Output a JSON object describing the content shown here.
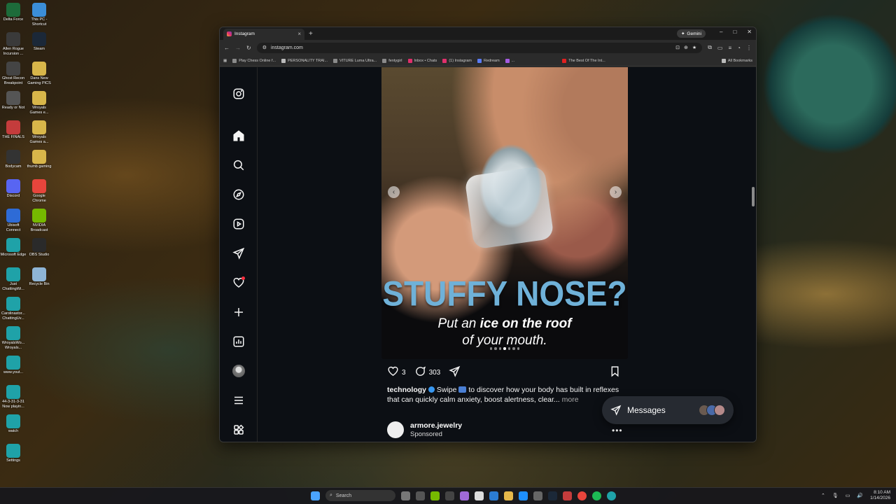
{
  "desktop": {
    "icons": [
      {
        "label": "Delta Force",
        "color": "#1d6b3a"
      },
      {
        "label": "This PC - Shortcut",
        "color": "#3b8ed8"
      },
      {
        "label": "Allen Rogue Incursion ...",
        "color": "#3a3a3a"
      },
      {
        "label": "Steam",
        "color": "#1b2838"
      },
      {
        "label": "Ghost Recon Breakpoint",
        "color": "#444"
      },
      {
        "label": "Dans New Gaming PICS",
        "color": "#d8b64a"
      },
      {
        "label": "Ready or Not",
        "color": "#555"
      },
      {
        "label": "Wroyals Games e...",
        "color": "#d8b64a"
      },
      {
        "label": "THE FINALS",
        "color": "#c43c3c"
      },
      {
        "label": "Wroyals Games a...",
        "color": "#d8b64a"
      },
      {
        "label": "Bodycam",
        "color": "#333"
      },
      {
        "label": "thumb gaming",
        "color": "#d8b64a"
      },
      {
        "label": "Discord",
        "color": "#5865f2"
      },
      {
        "label": "Google Chrome",
        "color": "#e8453c"
      },
      {
        "label": "Ubisoft Connect",
        "color": "#2e6bd6"
      },
      {
        "label": "NVIDIA Broadcast",
        "color": "#76b900"
      },
      {
        "label": "Microsoft Edge",
        "color": "#1fa2a8"
      },
      {
        "label": "OBS Studio",
        "color": "#2a2a2a"
      },
      {
        "label": "Just ChattingWi...",
        "color": "#1fa2a8"
      },
      {
        "label": "Recycle Bin",
        "color": "#8fb5d6"
      },
      {
        "label": "Carolinastor... ChattingUv...",
        "color": "#1fa2a8"
      },
      {
        "label": "WroyalsWo... Wroyals...",
        "color": "#1fa2a8"
      },
      {
        "label": "www.yout...",
        "color": "#1fa2a8"
      },
      {
        "label": "44-3-31-3-31 Now playin...",
        "color": "#1fa2a8"
      },
      {
        "label": "watch",
        "color": "#1fa2a8"
      },
      {
        "label": "Settings",
        "color": "#1fa2a8"
      }
    ]
  },
  "browser": {
    "tab_title": "Instagram",
    "new_tab": "+",
    "gemini": "Gemini",
    "window_controls": [
      "–",
      "□",
      "✕"
    ],
    "url": "instagram.com",
    "bookmarks": [
      "Play Chess Online f...",
      "PERSONALITY TRAI...",
      "VITURE Luma Ultra...",
      "fentygirl",
      "Inbox • Chats",
      "(1) Instagram",
      "Redream",
      "...",
      "The Best Of The Int..."
    ],
    "all_bookmarks": "All Bookmarks"
  },
  "instagram": {
    "post": {
      "headline": "STUFFY NOSE?",
      "sub_line1_pre": "Put an ",
      "sub_line1_bold": "ice on the roof",
      "sub_line2": "of your mouth.",
      "carousel_dots": 7,
      "active_dot": 4,
      "likes": "3",
      "comments": "303",
      "caption_user": "technology",
      "caption_pre": "Swipe",
      "caption_text": "to discover how your body has built in reflexes that can quickly calm anxiety, boost alertness, clear...",
      "more": "more"
    },
    "sponsored": {
      "username": "armore.jewelry",
      "label": "Sponsored",
      "menu": "•••"
    },
    "messages": {
      "label": "Messages"
    }
  },
  "taskbar": {
    "search_placeholder": "Search",
    "time": "8:10 AM",
    "date": "1/14/2026"
  },
  "colors": {
    "headline": "#6fb1d8",
    "notification": "#ff3040",
    "verified": "#3897f0"
  }
}
